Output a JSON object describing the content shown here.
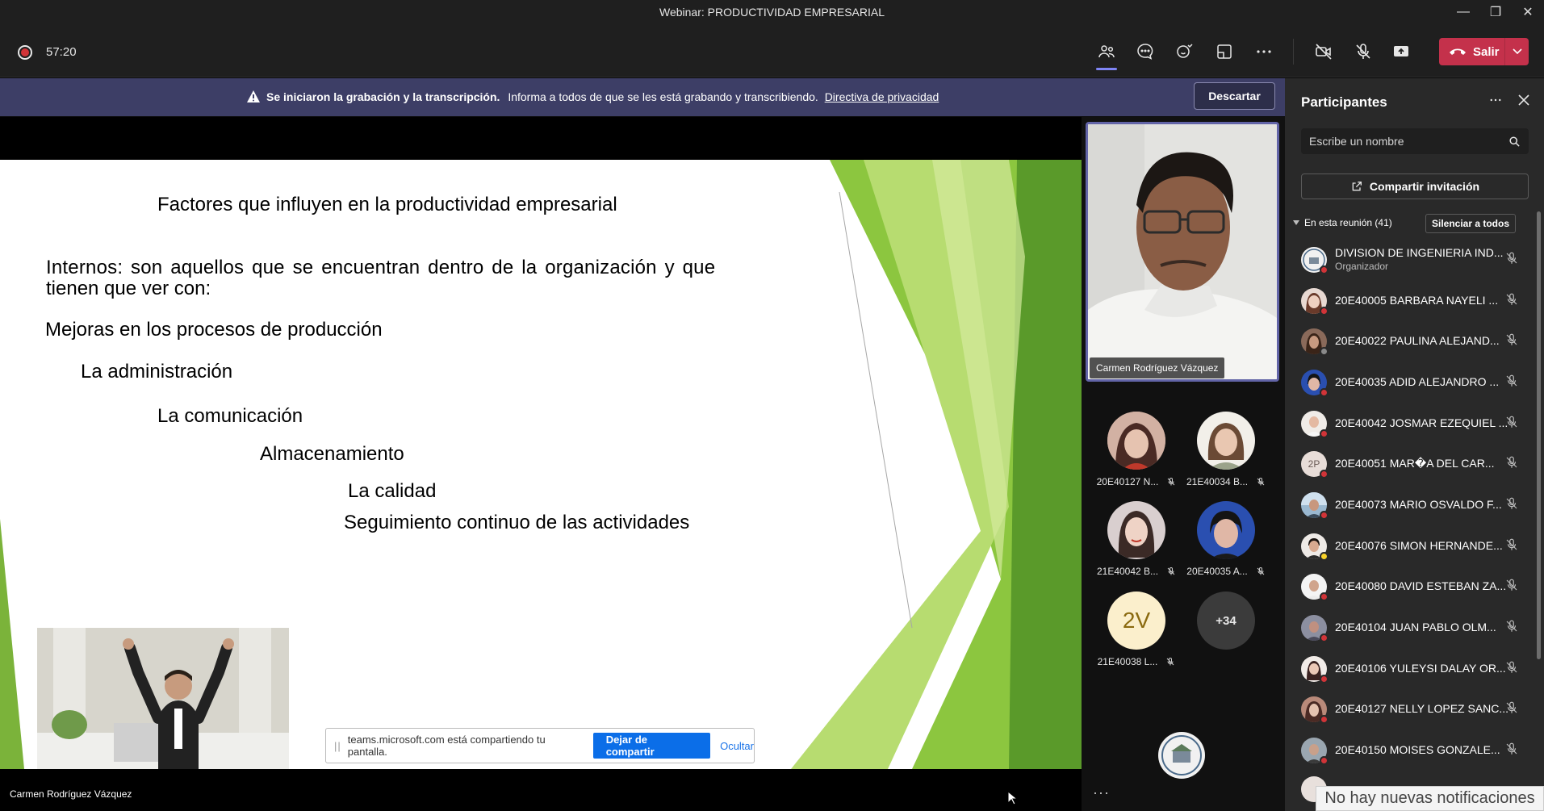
{
  "window": {
    "title": "Webinar: PRODUCTIVIDAD EMPRESARIAL"
  },
  "toolbar": {
    "timer": "57:20",
    "leave_label": "Salir"
  },
  "banner": {
    "bold": "Se iniciaron la grabación y la transcripción.",
    "text": "Informa a todos de que se les está grabando y transcribiendo.",
    "link": "Directiva de privacidad",
    "dismiss": "Descartar"
  },
  "slide": {
    "title": "Factores que influyen en la productividad empresarial",
    "intro_line1": "Internos: son aquellos que se encuentran dentro de la organización y que",
    "intro_line2": "tienen que ver con:",
    "items": [
      "Mejoras en los procesos de producción",
      "La administración",
      "La comunicación",
      "Almacenamiento",
      "La calidad",
      "Seguimiento continuo de las actividades"
    ]
  },
  "share_bar": {
    "text": "teams.microsoft.com está compartiendo tu pantalla.",
    "stop": "Dejar de compartir",
    "hide": "Ocultar"
  },
  "presenter": {
    "name": "Carmen Rodríguez Vázquez"
  },
  "gallery": {
    "tiles": [
      {
        "name": "20E40127 N..."
      },
      {
        "name": "21E40034 B..."
      },
      {
        "name": "21E40042 B..."
      },
      {
        "name": "20E40035 A..."
      },
      {
        "name": "21E40038 L...",
        "initials": "2V"
      },
      {
        "name": "",
        "initials": "+34"
      }
    ]
  },
  "panel": {
    "title": "Participantes",
    "search_placeholder": "Escribe un nombre",
    "invite": "Compartir invitación",
    "in_meeting": "En esta reunión (41)",
    "mute_all": "Silenciar a todos",
    "participants": [
      {
        "name": "DIVISION DE INGENIERIA IND...",
        "role": "Organizador"
      },
      {
        "name": "20E40005 BARBARA NAYELI ..."
      },
      {
        "name": "20E40022 PAULINA ALEJAND..."
      },
      {
        "name": "20E40035 ADID ALEJANDRO ..."
      },
      {
        "name": "20E40042 JOSMAR EZEQUIEL ..."
      },
      {
        "name": "20E40051 MAR�A DEL CAR...",
        "initials": "2P"
      },
      {
        "name": "20E40073 MARIO OSVALDO F..."
      },
      {
        "name": "20E40076 SIMON HERNANDE..."
      },
      {
        "name": "20E40080 DAVID ESTEBAN ZA..."
      },
      {
        "name": "20E40104 JUAN PABLO OLM..."
      },
      {
        "name": "20E40106 YULEYSI DALAY OR..."
      },
      {
        "name": "20E40127 NELLY LOPEZ SANC..."
      },
      {
        "name": "20E40150 MOISES GONZALE..."
      }
    ]
  },
  "toast": {
    "text": "No hay nuevas notificaciones"
  }
}
